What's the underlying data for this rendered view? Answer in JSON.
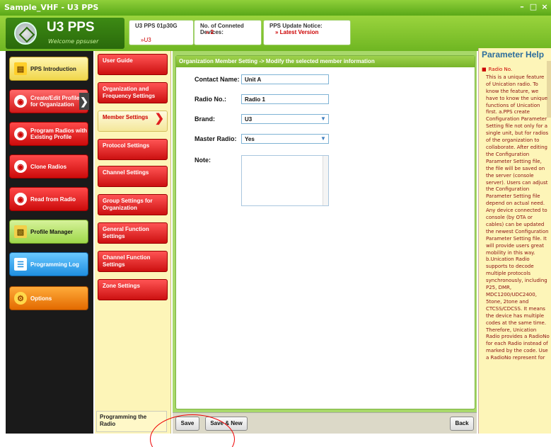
{
  "window": {
    "title": "Sample_VHF - U3 PPS",
    "controls": [
      "minimize",
      "maximize",
      "close"
    ]
  },
  "header": {
    "app_name": "U3 PPS",
    "welcome": "Welcome ppsuser",
    "info": [
      {
        "label": "U3 PPS 01p30G",
        "value": "»U3"
      },
      {
        "label": "No. of Conneted Devices:",
        "value": "» 2"
      },
      {
        "label": "PPS Update Notice:",
        "value": "» Latest Version"
      }
    ]
  },
  "left_nav": [
    {
      "label": "PPS Introduction",
      "style": "yellow",
      "icon": "document-icon"
    },
    {
      "label": "Create/Edit Profiles for Organization",
      "style": "red",
      "icon": "pps-icon",
      "active": true
    },
    {
      "label": "Program Radios with Existing Profile",
      "style": "red",
      "icon": "pps-icon"
    },
    {
      "label": "Clone Radios",
      "style": "red",
      "icon": "pps-icon"
    },
    {
      "label": "Read from Radio",
      "style": "red",
      "icon": "pps-icon"
    },
    {
      "label": "Profile Manager",
      "style": "green",
      "icon": "folder-icon"
    },
    {
      "label": "Programming Log",
      "style": "blue",
      "icon": "log-icon"
    },
    {
      "label": "Options",
      "style": "orange",
      "icon": "gear-icon"
    }
  ],
  "submenu": [
    {
      "label": "User Guide"
    },
    {
      "label": "Organization and Frequency Settings"
    },
    {
      "label": "Member Settings",
      "selected": true
    },
    {
      "label": "Protocol Settings"
    },
    {
      "label": "Channel Settings"
    },
    {
      "label": "Group Settings for Organization"
    },
    {
      "label": "General Function Settings"
    },
    {
      "label": "Channel Function Settings"
    },
    {
      "label": "Zone Settings"
    }
  ],
  "submenu_bottom": "Programming the Radio",
  "main": {
    "heading": "Organization Member Setting -> Modify the selected member information",
    "fields": {
      "contact_name_label": "Contact Name:",
      "contact_name_value": "Unit A",
      "radio_no_label": "Radio No.:",
      "radio_no_value": "Radio 1",
      "brand_label": "Brand:",
      "brand_value": "U3",
      "master_radio_label": "Master Radio:",
      "master_radio_value": "Yes",
      "note_label": "Note:"
    },
    "buttons": {
      "save": "Save",
      "save_new": "Save & New",
      "back": "Back"
    }
  },
  "help": {
    "title": "Parameter Help",
    "heading": "Radio No.",
    "text": "This is a unique feature of Unication radio. To know the feature, we have to know the unique functions of Unication first. a.PPS create Configuration Parameter Setting file not only for a single unit, but for radios of the organization to collaborate. After editing the Configuration Parameter Setting file, the file will be saved on the server (console server). Users can adjust the Configuration Parameter Setting file depend on actual need. Any device connected to console (by OTA or cables) can be updated the newest Configuration Parameter Setting file. It will provide users great mobility in this way. b.Unication Radio supports to decode multiple protocols synchronously, including P25, DMR, MDC1200/UDC2400, 5tone, 2tone and CTCSS/CDCSS. It means the device has multiple codes at the same time. Therefore, Unication Radio provides a RadioNo for each Radio instead of marked by the code. Use a RadioNo represent for"
  },
  "colors": {
    "brand_green": "#6fb622",
    "nav_red": "#cc0b0b",
    "help_text": "#8b1010",
    "annotation": "#e00000"
  }
}
